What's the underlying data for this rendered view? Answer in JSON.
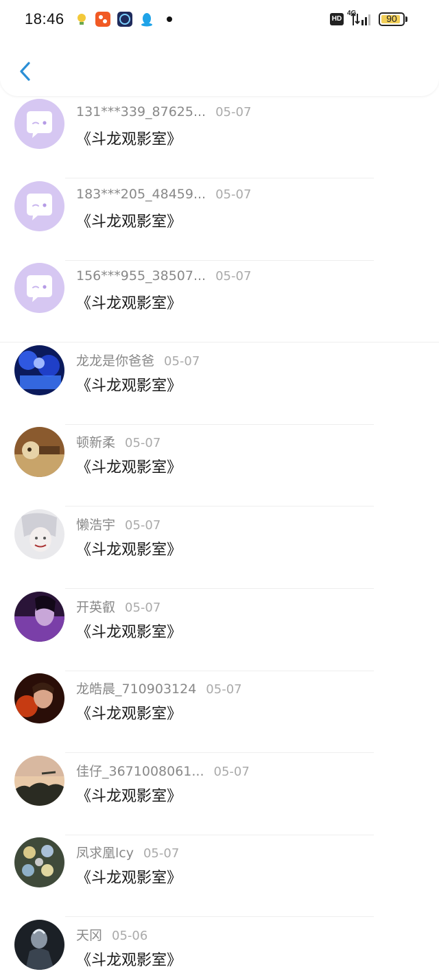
{
  "status_bar": {
    "time": "18:46",
    "hd": "HD",
    "network": "4G",
    "battery": "90",
    "battery_level": 0.9
  },
  "header": {
    "back_icon": "chevron-left-icon",
    "accent": "#2b8fd6"
  },
  "comments": [
    {
      "name": "131***339_87625...",
      "date": "05-07",
      "text": "《斗龙观影室》",
      "avatar": "default-bot"
    },
    {
      "name": "183***205_48459...",
      "date": "05-07",
      "text": "《斗龙观影室》",
      "avatar": "default-bot"
    },
    {
      "name": "156***955_38507...",
      "date": "05-07",
      "text": "《斗龙观影室》",
      "avatar": "default-bot"
    },
    {
      "name": "龙龙是你爸爸",
      "date": "05-07",
      "text": "《斗龙观影室》",
      "avatar": "photo-blue-crowd"
    },
    {
      "name": "顿新柔",
      "date": "05-07",
      "text": "《斗龙观影室》",
      "avatar": "photo-warm-cat"
    },
    {
      "name": "懒浩宇",
      "date": "05-07",
      "text": "《斗龙观影室》",
      "avatar": "anime-pale"
    },
    {
      "name": "开英叡",
      "date": "05-07",
      "text": "《斗龙观影室》",
      "avatar": "photo-purple-portrait"
    },
    {
      "name": "龙皓晨_710903124",
      "date": "05-07",
      "text": "《斗龙观影室》",
      "avatar": "photo-warrior"
    },
    {
      "name": "佳仔_3671008061...",
      "date": "05-07",
      "text": "《斗龙观影室》",
      "avatar": "photo-sunset-trees"
    },
    {
      "name": "凤求凰lcy",
      "date": "05-07",
      "text": "《斗龙观影室》",
      "avatar": "photo-badges"
    },
    {
      "name": "天冈",
      "date": "05-06",
      "text": "《斗龙观影室》",
      "avatar": "photo-dark-figure"
    }
  ]
}
